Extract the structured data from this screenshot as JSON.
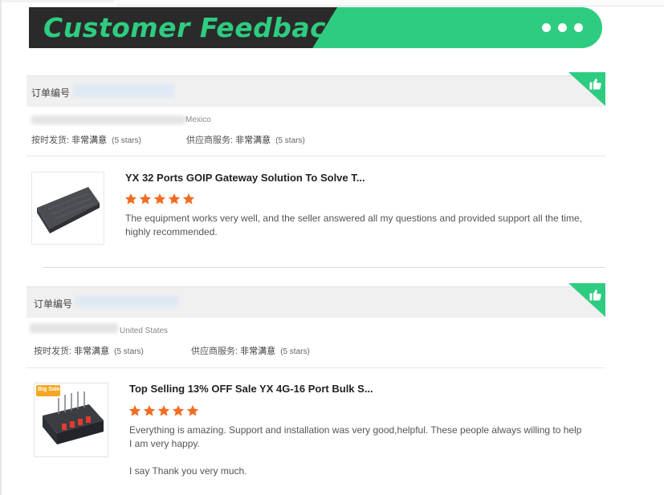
{
  "header": {
    "title": "Customer Feedback",
    "colors": {
      "green": "#2ecc80",
      "dark": "#2a2a2a",
      "star": "#f26d21"
    }
  },
  "reviews": [
    {
      "order_label": "订单编号",
      "country": "Mexico",
      "shipping_label": "按时发货:",
      "shipping_value": "非常满意",
      "shipping_stars": "(5 stars)",
      "supplier_label": "供应商服务:",
      "supplier_value": "非常满意",
      "supplier_stars": "(5 stars)",
      "product_title": "YX 32 Ports GOIP Gateway Solution To Solve T...",
      "rating": 5,
      "text": "The equipment works very well, and the seller answered all my questions and provided support all the time, highly recommended."
    },
    {
      "order_label": "订单编号",
      "country": "United States",
      "shipping_label": "按时发货:",
      "shipping_value": "非常满意",
      "shipping_stars": "(5 stars)",
      "supplier_label": "供应商服务:",
      "supplier_value": "非常满意",
      "supplier_stars": "(5 stars)",
      "product_title": "Top Selling 13% OFF Sale YX 4G-16 Port Bulk S...",
      "rating": 5,
      "text": "Everything is amazing. Support and installation was very good,helpful. These people always willing to help\nI am very happy.\n\nI say Thank you very much.",
      "badge": "Big Sale"
    }
  ]
}
